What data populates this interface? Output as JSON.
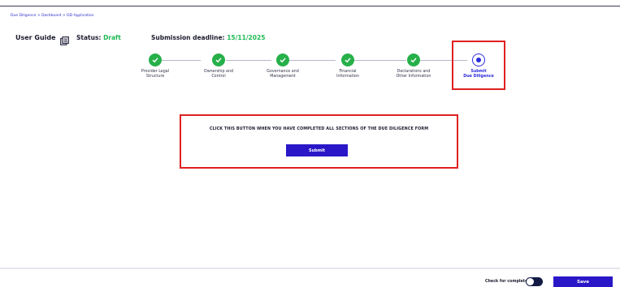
{
  "breadcrumb": "Due Diligence > Dashboard > DD Application",
  "user_guide": {
    "label": "User Guide",
    "icon": "document-copy-icon"
  },
  "status": {
    "label": "Status:",
    "value": "Draft",
    "value_color": "#1db954"
  },
  "deadline": {
    "label": "Submission deadline:",
    "value": "15/11/2025"
  },
  "steps": [
    {
      "line1": "Provider Legal",
      "line2": "Structure",
      "state": "complete"
    },
    {
      "line1": "Ownership and",
      "line2": "Control",
      "state": "complete"
    },
    {
      "line1": "Governance and",
      "line2": "Management",
      "state": "complete"
    },
    {
      "line1": "Financial",
      "line2": "Information",
      "state": "complete"
    },
    {
      "line1": "Declarations and",
      "line2": "Other Information",
      "state": "complete"
    },
    {
      "line1": "Submit",
      "line2": "Due Diligence",
      "state": "current"
    }
  ],
  "submit_section": {
    "message": "CLICK THIS BUTTON WHEN YOU HAVE COMPLETED ALL SECTIONS OF THE DUE DILIGENCE FORM",
    "button_label": "Submit"
  },
  "footer": {
    "check_label": "Check for completeness",
    "toggle_on": true,
    "save_label": "Save"
  },
  "colors": {
    "accent": "#2a18c8",
    "success": "#27b04a",
    "highlight": "#e02020"
  }
}
